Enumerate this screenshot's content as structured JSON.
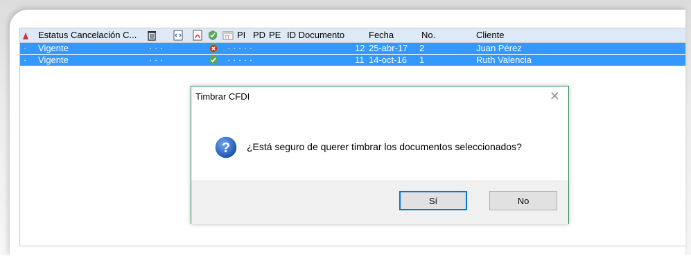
{
  "grid": {
    "columns": [
      "Estatus Cancelación C...",
      "PI",
      "PD",
      "PE",
      "ID Documento",
      "Fecha",
      "No.",
      "Cliente"
    ],
    "column_icons": [
      "trash-icon",
      "xml-icon",
      "pdf-icon",
      "stamp-check-icon",
      "date-icon"
    ],
    "rows": [
      {
        "estatus": "Vigente",
        "dots": "·  ·  ·",
        "dots2": "·  ·  ·  ·  ·",
        "id": "12",
        "fecha": "25-abr-17",
        "no": "2",
        "cliente": "Juan Pérez",
        "stamp": "error"
      },
      {
        "estatus": "Vigente",
        "dots": "·  ·  ·",
        "dots2": "·  ·  ·  ·  ·",
        "id": "11",
        "fecha": "14-oct-16",
        "no": "1",
        "cliente": "Ruth Valencia",
        "stamp": "ok"
      }
    ],
    "row_marker": "·"
  },
  "dialog": {
    "title": "Timbrar CFDI",
    "message": "¿Está seguro de querer timbrar los documentos seleccionados?",
    "yes_label": "Sí",
    "no_label": "No",
    "close_glyph": "✕",
    "icon": "question-icon"
  },
  "colors": {
    "selection": "#3399ff",
    "header": "#dde9f7",
    "dialog_border": "#2e8b57"
  }
}
